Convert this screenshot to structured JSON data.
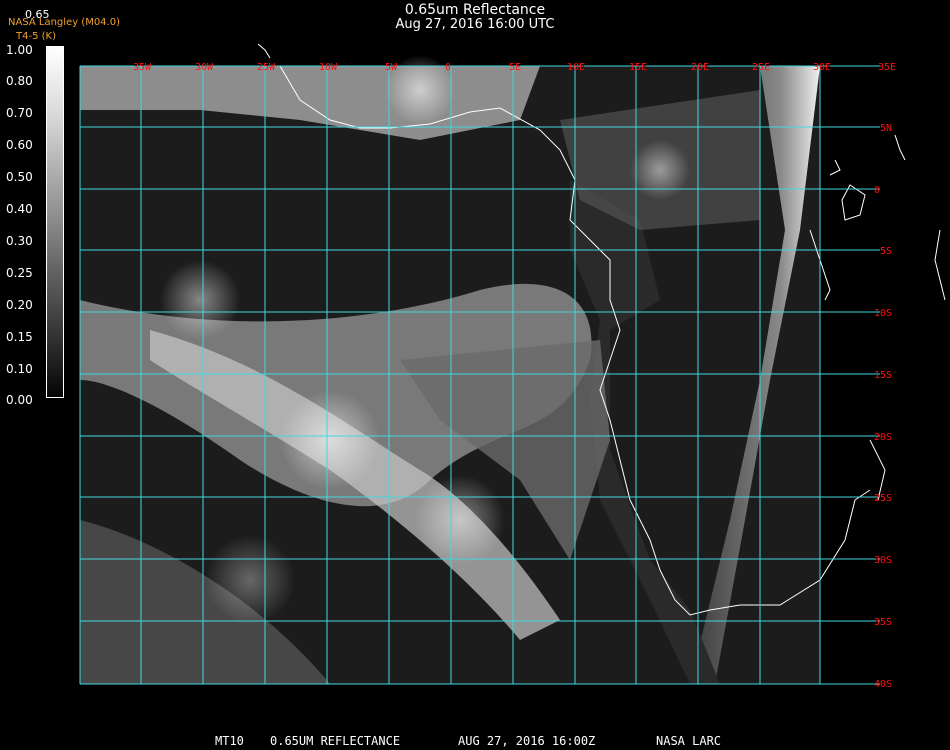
{
  "header": {
    "title": "0.65um Reflectance",
    "subtitle": "Aug 27, 2016 16:00 UTC",
    "credit_line1": "NASA Langley (M04.0)",
    "credit_line2": "T4-5 (K)",
    "scale_top": "0.65"
  },
  "colorbar": {
    "labels": [
      "1.00",
      "0.80",
      "0.70",
      "0.60",
      "0.50",
      "0.40",
      "0.30",
      "0.25",
      "0.20",
      "0.15",
      "0.10",
      "0.00"
    ]
  },
  "map": {
    "longitude_labels": [
      "35W",
      "30W",
      "25W",
      "10W",
      "5W",
      "0",
      "5E",
      "10E",
      "15E",
      "20E",
      "25E",
      "30E",
      "35E"
    ],
    "latitude_labels": [
      "5N",
      "0",
      "5S",
      "10S",
      "15S",
      "20S",
      "25S",
      "30S",
      "35S",
      "40S"
    ],
    "grid_color": "#40d8e0",
    "label_color": "#ff1010",
    "coast_color": "#ffffff"
  },
  "footer": {
    "product": "MT10",
    "channel": "0.65UM REFLECTANCE",
    "datetime": "AUG 27, 2016 16:00Z",
    "source": "NASA LARC"
  }
}
